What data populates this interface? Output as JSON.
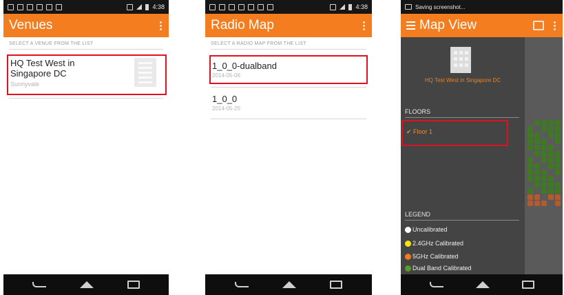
{
  "status": {
    "time": "4:38",
    "notification": "Saving screenshot..."
  },
  "screens": {
    "venues": {
      "title": "Venues",
      "section": "SELECT A VENUE FROM THE LIST",
      "items": [
        {
          "name": "HQ Test West in Singapore DC",
          "location": "Sunnyvale"
        }
      ]
    },
    "radio_map": {
      "title": "Radio Map",
      "section": "SELECT A RADIO MAP FROM THE LIST",
      "items": [
        {
          "name": "1_0_0-dualband",
          "date": "2014-05-06"
        },
        {
          "name": "1_0_0",
          "date": "2014-05-25"
        }
      ]
    },
    "map_view": {
      "title": "Map View",
      "venue_name": "HQ Test West in Singapore DC",
      "floors_header": "FLOORS",
      "floor": "Floor 1",
      "legend_header": "LEGEND",
      "legend": [
        {
          "label": "Uncalibrated",
          "color": "#ffffff"
        },
        {
          "label": "2.4GHz Calibrated",
          "color": "#f6e21a"
        },
        {
          "label": "5GHz Calibrated",
          "color": "#f07a20"
        },
        {
          "label": "Dual Band Calibrated",
          "color": "#5a9c2a"
        }
      ]
    }
  },
  "colors": {
    "accent": "#f47d20",
    "highlight": "#e0101e",
    "drawer": "#444444"
  }
}
